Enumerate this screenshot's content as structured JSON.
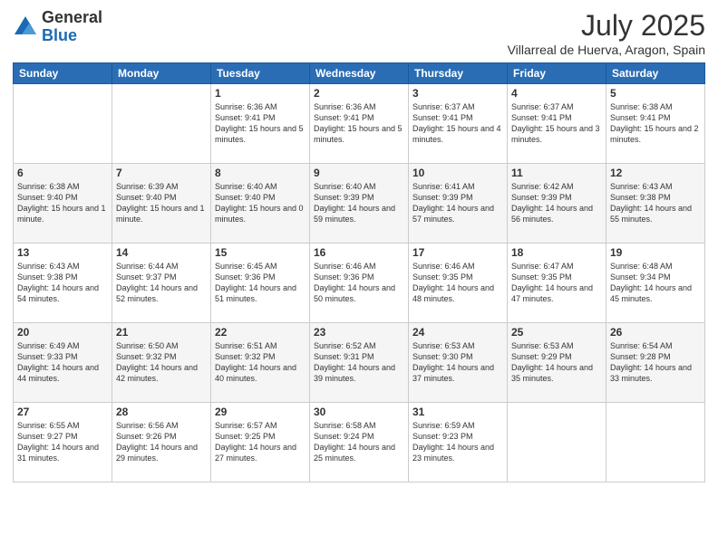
{
  "header": {
    "logo_general": "General",
    "logo_blue": "Blue",
    "main_title": "July 2025",
    "subtitle": "Villarreal de Huerva, Aragon, Spain"
  },
  "weekdays": [
    "Sunday",
    "Monday",
    "Tuesday",
    "Wednesday",
    "Thursday",
    "Friday",
    "Saturday"
  ],
  "weeks": [
    [
      {
        "day": "",
        "info": ""
      },
      {
        "day": "",
        "info": ""
      },
      {
        "day": "1",
        "info": "Sunrise: 6:36 AM\nSunset: 9:41 PM\nDaylight: 15 hours and 5 minutes."
      },
      {
        "day": "2",
        "info": "Sunrise: 6:36 AM\nSunset: 9:41 PM\nDaylight: 15 hours and 5 minutes."
      },
      {
        "day": "3",
        "info": "Sunrise: 6:37 AM\nSunset: 9:41 PM\nDaylight: 15 hours and 4 minutes."
      },
      {
        "day": "4",
        "info": "Sunrise: 6:37 AM\nSunset: 9:41 PM\nDaylight: 15 hours and 3 minutes."
      },
      {
        "day": "5",
        "info": "Sunrise: 6:38 AM\nSunset: 9:41 PM\nDaylight: 15 hours and 2 minutes."
      }
    ],
    [
      {
        "day": "6",
        "info": "Sunrise: 6:38 AM\nSunset: 9:40 PM\nDaylight: 15 hours and 1 minute."
      },
      {
        "day": "7",
        "info": "Sunrise: 6:39 AM\nSunset: 9:40 PM\nDaylight: 15 hours and 1 minute."
      },
      {
        "day": "8",
        "info": "Sunrise: 6:40 AM\nSunset: 9:40 PM\nDaylight: 15 hours and 0 minutes."
      },
      {
        "day": "9",
        "info": "Sunrise: 6:40 AM\nSunset: 9:39 PM\nDaylight: 14 hours and 59 minutes."
      },
      {
        "day": "10",
        "info": "Sunrise: 6:41 AM\nSunset: 9:39 PM\nDaylight: 14 hours and 57 minutes."
      },
      {
        "day": "11",
        "info": "Sunrise: 6:42 AM\nSunset: 9:39 PM\nDaylight: 14 hours and 56 minutes."
      },
      {
        "day": "12",
        "info": "Sunrise: 6:43 AM\nSunset: 9:38 PM\nDaylight: 14 hours and 55 minutes."
      }
    ],
    [
      {
        "day": "13",
        "info": "Sunrise: 6:43 AM\nSunset: 9:38 PM\nDaylight: 14 hours and 54 minutes."
      },
      {
        "day": "14",
        "info": "Sunrise: 6:44 AM\nSunset: 9:37 PM\nDaylight: 14 hours and 52 minutes."
      },
      {
        "day": "15",
        "info": "Sunrise: 6:45 AM\nSunset: 9:36 PM\nDaylight: 14 hours and 51 minutes."
      },
      {
        "day": "16",
        "info": "Sunrise: 6:46 AM\nSunset: 9:36 PM\nDaylight: 14 hours and 50 minutes."
      },
      {
        "day": "17",
        "info": "Sunrise: 6:46 AM\nSunset: 9:35 PM\nDaylight: 14 hours and 48 minutes."
      },
      {
        "day": "18",
        "info": "Sunrise: 6:47 AM\nSunset: 9:35 PM\nDaylight: 14 hours and 47 minutes."
      },
      {
        "day": "19",
        "info": "Sunrise: 6:48 AM\nSunset: 9:34 PM\nDaylight: 14 hours and 45 minutes."
      }
    ],
    [
      {
        "day": "20",
        "info": "Sunrise: 6:49 AM\nSunset: 9:33 PM\nDaylight: 14 hours and 44 minutes."
      },
      {
        "day": "21",
        "info": "Sunrise: 6:50 AM\nSunset: 9:32 PM\nDaylight: 14 hours and 42 minutes."
      },
      {
        "day": "22",
        "info": "Sunrise: 6:51 AM\nSunset: 9:32 PM\nDaylight: 14 hours and 40 minutes."
      },
      {
        "day": "23",
        "info": "Sunrise: 6:52 AM\nSunset: 9:31 PM\nDaylight: 14 hours and 39 minutes."
      },
      {
        "day": "24",
        "info": "Sunrise: 6:53 AM\nSunset: 9:30 PM\nDaylight: 14 hours and 37 minutes."
      },
      {
        "day": "25",
        "info": "Sunrise: 6:53 AM\nSunset: 9:29 PM\nDaylight: 14 hours and 35 minutes."
      },
      {
        "day": "26",
        "info": "Sunrise: 6:54 AM\nSunset: 9:28 PM\nDaylight: 14 hours and 33 minutes."
      }
    ],
    [
      {
        "day": "27",
        "info": "Sunrise: 6:55 AM\nSunset: 9:27 PM\nDaylight: 14 hours and 31 minutes."
      },
      {
        "day": "28",
        "info": "Sunrise: 6:56 AM\nSunset: 9:26 PM\nDaylight: 14 hours and 29 minutes."
      },
      {
        "day": "29",
        "info": "Sunrise: 6:57 AM\nSunset: 9:25 PM\nDaylight: 14 hours and 27 minutes."
      },
      {
        "day": "30",
        "info": "Sunrise: 6:58 AM\nSunset: 9:24 PM\nDaylight: 14 hours and 25 minutes."
      },
      {
        "day": "31",
        "info": "Sunrise: 6:59 AM\nSunset: 9:23 PM\nDaylight: 14 hours and 23 minutes."
      },
      {
        "day": "",
        "info": ""
      },
      {
        "day": "",
        "info": ""
      }
    ]
  ]
}
